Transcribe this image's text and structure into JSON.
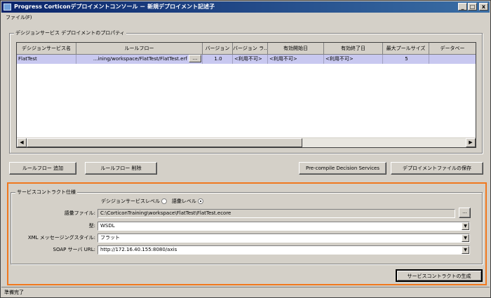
{
  "window": {
    "title": "Progress Corticonデプロイメントコンソール － 新規デプロイメント記述子",
    "minimize": "_",
    "maximize": "□",
    "close": "x"
  },
  "menu": {
    "file": "ファイル(F)"
  },
  "properties_group": {
    "title": "デシジョンサービス デプロイメントのプロパティ",
    "columns": [
      "デシジョンサービス名",
      "ルールフロー",
      "バージョン",
      "バージョン ラ...",
      "有効開始日",
      "有効終了日",
      "最大プールサイズ",
      "データベー"
    ],
    "rows": [
      {
        "name": "FlatTest",
        "ruleflow": "...ining/workspace/FlatTest/FlatTest.erf",
        "browse": "...",
        "version": "1.0",
        "version_label": "<利用不可>",
        "start_date": "<利用不可>",
        "end_date": "<利用不可>",
        "max_pool": "5",
        "database": ""
      }
    ]
  },
  "buttons": {
    "add_ruleflow": "ルールフロー 追加",
    "remove_ruleflow": "ルールフロー 削除",
    "precompile": "Pre-compile Decision Services",
    "save_deployment": "デプロイメントファイルの保存",
    "generate_contract": "サービスコントラクトの生成"
  },
  "contract_group": {
    "title": "サービスコントラクト仕様",
    "level_decision": "デシジョンサービスレベル",
    "level_vocab": "語彙レベル",
    "vocab_file_label": "語彙ファイル:",
    "vocab_file_value": "C:\\CorticonTraining\\workspace\\FlatTest\\FlatTest.ecore",
    "browse": "...",
    "type_label": "型:",
    "type_value": "WSDL",
    "xml_style_label": "XML メッセージングスタイル:",
    "xml_style_value": "フラット",
    "soap_url_label": "SOAP サーバ URL:",
    "soap_url_value": "http://172.16.40.155:8080/axis"
  },
  "status": {
    "text": "準備完了"
  },
  "colors": {
    "accent_outline": "#f0781e",
    "title_bar": "#0a246a",
    "selected_row": "#c8c8f0"
  }
}
